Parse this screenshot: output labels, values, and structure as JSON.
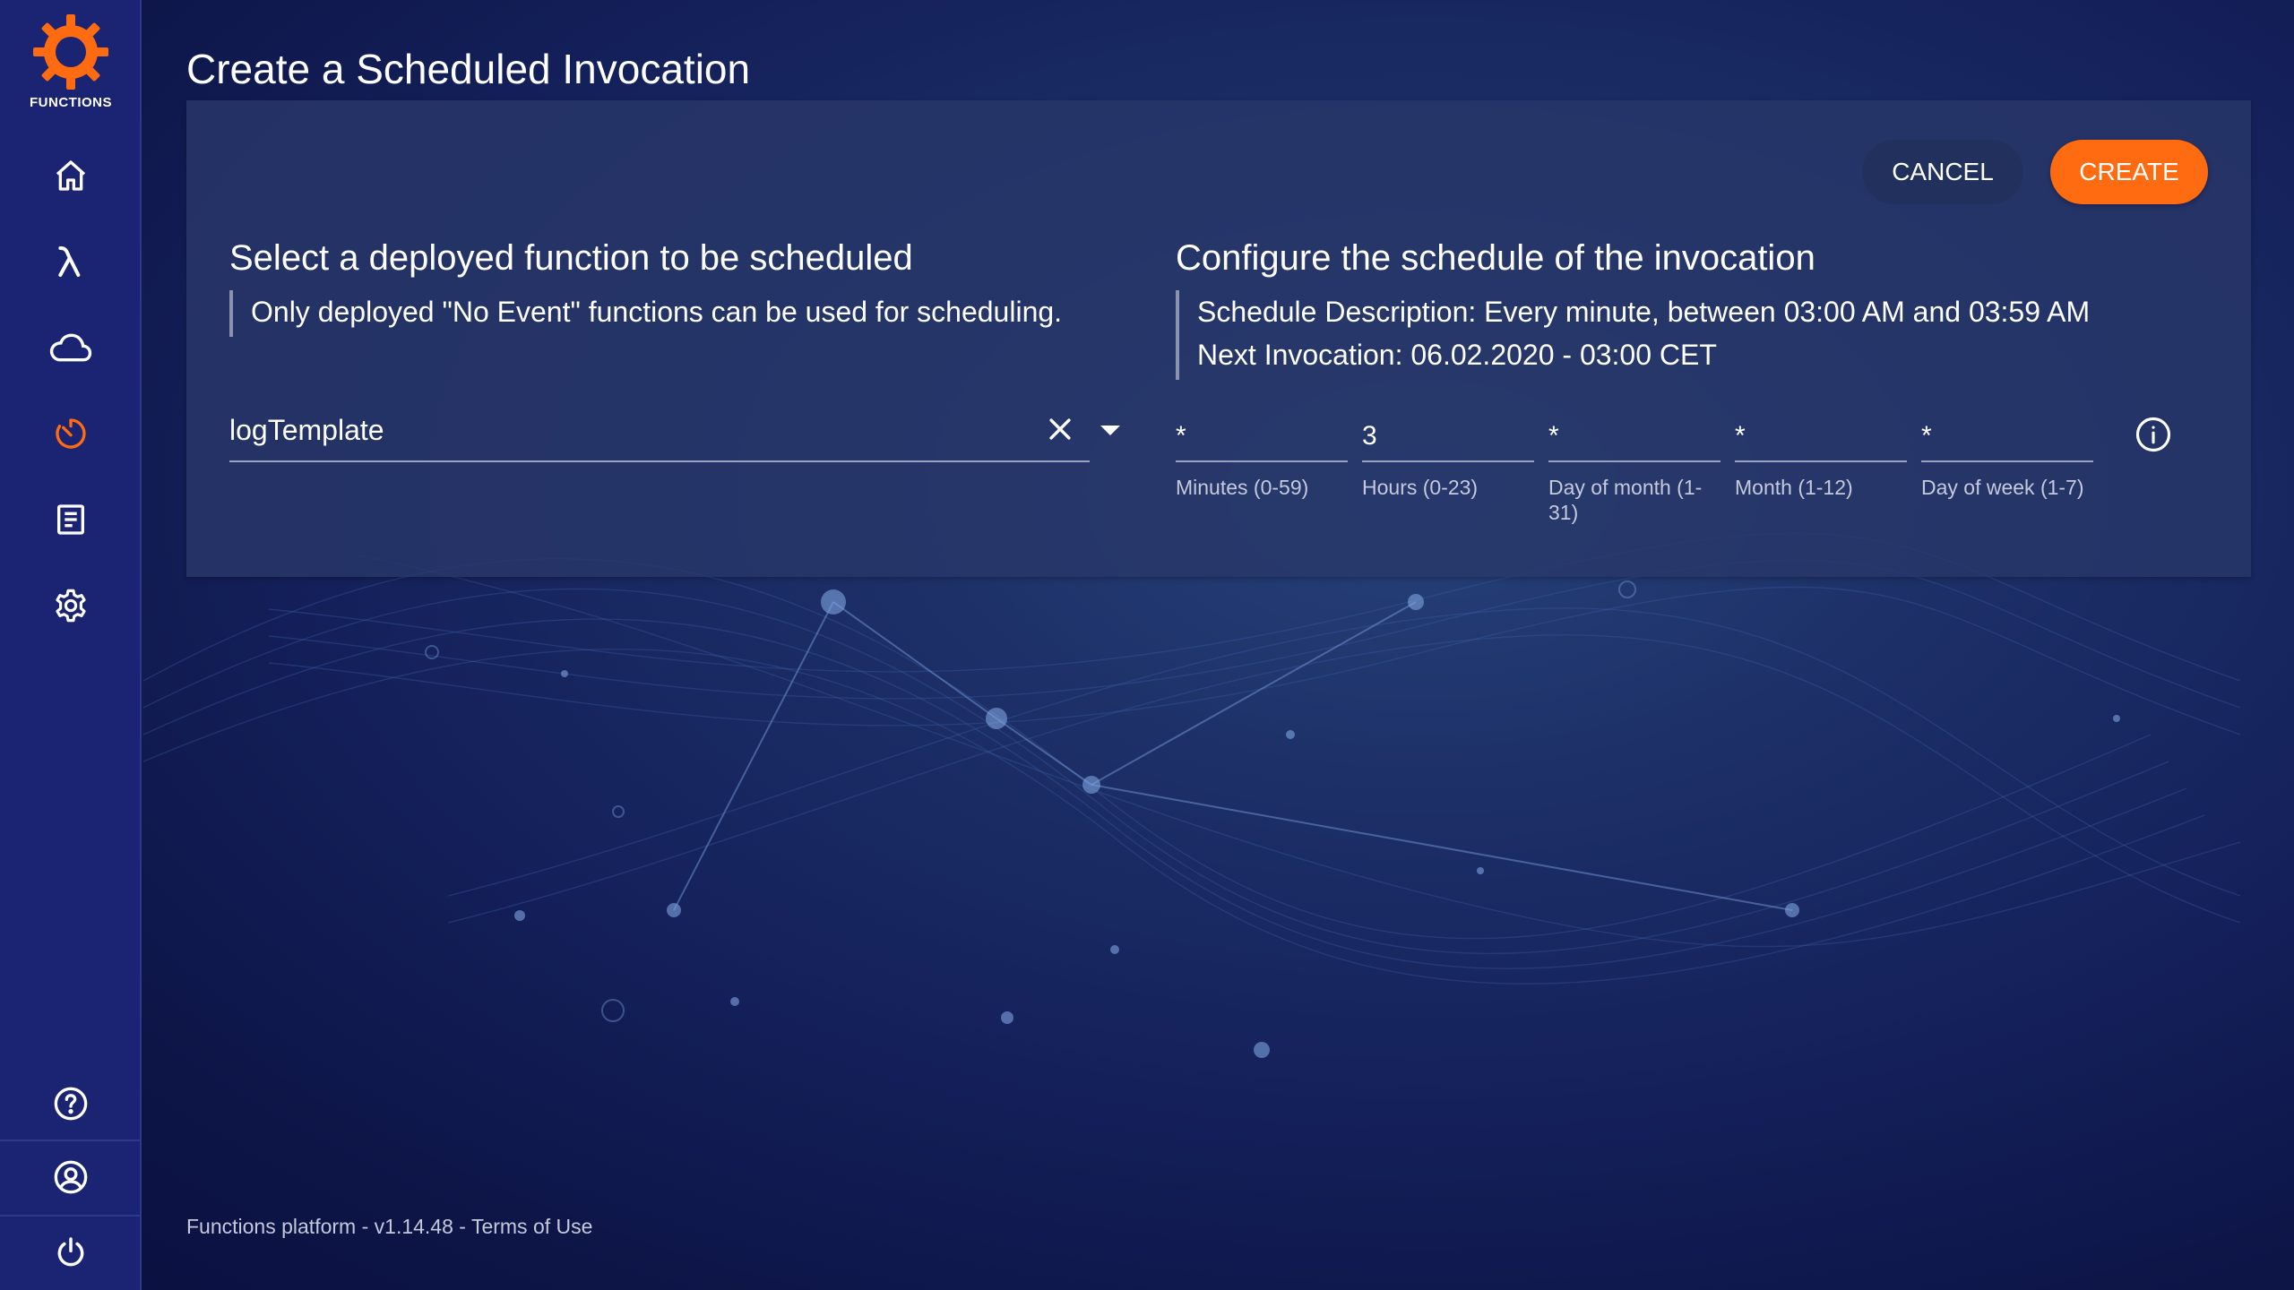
{
  "sidebar": {
    "logo_text": "FUNCTIONS",
    "items": [
      {
        "name": "home",
        "icon": "home-icon"
      },
      {
        "name": "functions",
        "icon": "lambda-icon"
      },
      {
        "name": "cloud",
        "icon": "cloud-icon"
      },
      {
        "name": "schedules",
        "icon": "timer-icon",
        "active": true
      },
      {
        "name": "logs",
        "icon": "document-icon"
      },
      {
        "name": "settings",
        "icon": "gear-icon"
      }
    ],
    "bottom_items": [
      {
        "name": "help",
        "icon": "help-circle-icon"
      },
      {
        "name": "account",
        "icon": "user-circle-icon"
      },
      {
        "name": "logout",
        "icon": "power-icon"
      }
    ]
  },
  "page": {
    "title": "Create a Scheduled Invocation"
  },
  "actions": {
    "cancel_label": "CANCEL",
    "create_label": "CREATE"
  },
  "function_section": {
    "title": "Select a deployed function to be scheduled",
    "note": "Only deployed \"No Event\" functions can be used for scheduling.",
    "selected_function": "logTemplate"
  },
  "schedule_section": {
    "title": "Configure the schedule of the invocation",
    "description": "Schedule Description: Every minute, between 03:00 AM and 03:59 AM",
    "next_invocation": "Next Invocation: 06.02.2020 - 03:00 CET",
    "fields": [
      {
        "value": "*",
        "label": "Minutes (0-59)"
      },
      {
        "value": "3",
        "label": "Hours (0-23)"
      },
      {
        "value": "*",
        "label": "Day of month (1-31)"
      },
      {
        "value": "*",
        "label": "Month (1-12)"
      },
      {
        "value": "*",
        "label": "Day of week (1-7)"
      }
    ]
  },
  "footer": {
    "platform": "Functions platform",
    "version": "v1.14.48",
    "terms": "Terms of Use"
  },
  "colors": {
    "accent": "#ff6b10",
    "sidebar": "#1a2472",
    "card": "#283769"
  }
}
